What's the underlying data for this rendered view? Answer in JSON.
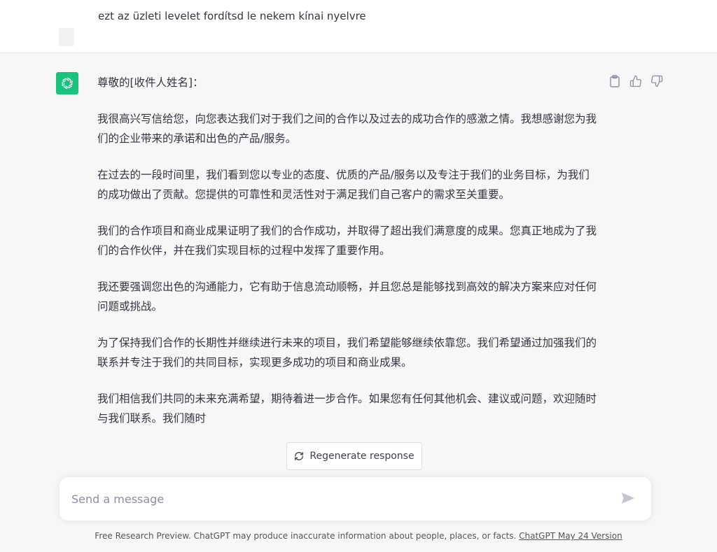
{
  "user_message": {
    "text": "ezt az üzleti levelet fordítsd le nekem kínai nyelvre"
  },
  "assistant_message": {
    "paragraphs": [
      "尊敬的[收件人姓名]：",
      "我很高兴写信给您，向您表达我们对于我们之间的合作以及过去的成功合作的感激之情。我想感谢您为我们的企业带来的承诺和出色的产品/服务。",
      "在过去的一段时间里，我们看到您以专业的态度、优质的产品/服务以及专注于我们的业务目标，为我们的成功做出了贡献。您提供的可靠性和灵活性对于满足我们自己客户的需求至关重要。",
      "我们的合作项目和商业成果证明了我们的合作成功，并取得了超出我们满意度的成果。您真正地成为了我们的合作伙伴，并在我们实现目标的过程中发挥了重要作用。",
      "我还要强调您出色的沟通能力，它有助于信息流动顺畅，并且您总是能够找到高效的解决方案来应对任何问题或挑战。",
      "为了保持我们合作的长期性并继续进行未来的项目，我们希望能够继续依靠您。我们希望通过加强我们的联系并专注于我们的共同目标，实现更多成功的项目和商业成果。",
      "我们相信我们共同的未来充满希望，期待着进一步合作。如果您有任何其他机会、建议或问题，欢迎随时与我们联系。我们随时"
    ]
  },
  "regenerate": {
    "label": "Regenerate response"
  },
  "composer": {
    "placeholder": "Send a message"
  },
  "footer": {
    "text": "Free Research Preview. ChatGPT may produce inaccurate information about people, places, or facts. ",
    "link": "ChatGPT May 24 Version"
  },
  "colors": {
    "accent": "#19c37d",
    "background": "#f7f7f8"
  },
  "icons": [
    "openai-logo-icon",
    "clipboard-icon",
    "thumbs-up-icon",
    "thumbs-down-icon",
    "refresh-icon",
    "send-icon"
  ]
}
